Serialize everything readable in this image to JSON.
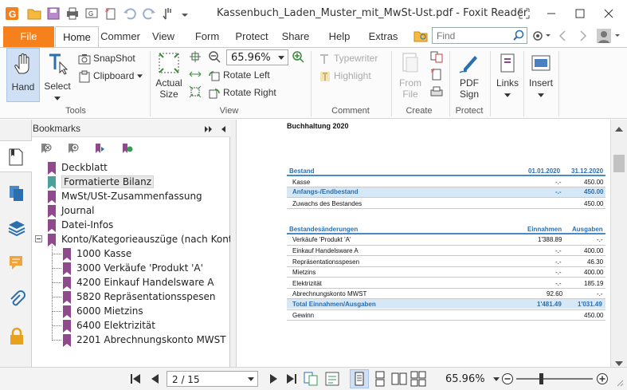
{
  "window": {
    "title": "Kassenbuch_Laden_Muster_mit_MwSt-Ust.pdf - Foxit Reader"
  },
  "menu": {
    "file": "File",
    "tabs": [
      "Home",
      "Commer",
      "View",
      "Form",
      "Protect",
      "Share",
      "Help",
      "Extras"
    ],
    "find_placeholder": "Find"
  },
  "ribbon": {
    "tools": {
      "hand": "Hand",
      "select": "Select",
      "snapshot": "SnapShot",
      "clipboard": "Clipboard",
      "label": "Tools"
    },
    "view": {
      "actual_size_1": "Actual",
      "actual_size_2": "Size",
      "zoom_value": "65.96%",
      "rotate_left": "Rotate Left",
      "rotate_right": "Rotate Right",
      "label": "View"
    },
    "comment": {
      "typewriter": "Typewriter",
      "highlight": "Highlight",
      "label": "Comment"
    },
    "create": {
      "from_file_1": "From",
      "from_file_2": "File",
      "label": "Create"
    },
    "protect": {
      "pdf_sign_1": "PDF",
      "pdf_sign_2": "Sign",
      "label": "Protect"
    },
    "links": {
      "links": "Links"
    },
    "insert": {
      "insert": "Insert"
    }
  },
  "bookmarks": {
    "title": "Bookmarks",
    "items": [
      "Deckblatt",
      "Formatierte Bilanz",
      "MwSt/USt-Zusammenfassung",
      "Journal",
      "Datei-Infos",
      "Konto/Kategorieauszüge (nach Konto"
    ],
    "children": [
      "1000 Kasse",
      "3000 Verkäufe 'Produkt 'A'",
      "4200 Einkauf Handelsware A",
      "5820 Repräsentationsspesen",
      "6000 Mietzins",
      "6400 Elektrizität",
      "2201 Abrechnungskonto MWST"
    ]
  },
  "document": {
    "heading": "Buchhaltung 2020",
    "table1": {
      "headers": [
        "Bestand",
        "01.01.2020",
        "31.12.2020"
      ],
      "rows": [
        [
          "Kasse",
          "-.-",
          "450.00"
        ],
        [
          "Anfangs-/Endbestand",
          "-.-",
          "450.00"
        ],
        [
          "Zuwachs des Bestandes",
          "",
          "450.00"
        ]
      ]
    },
    "table2": {
      "headers": [
        "Bestandesänderungen",
        "Einnahmen",
        "Ausgaben"
      ],
      "rows": [
        [
          "Verkäufe 'Produkt 'A'",
          "1'388.89",
          "-.-"
        ],
        [
          "Einkauf Handelsware A",
          "-.-",
          "400.00"
        ],
        [
          "Repräsentationsspesen",
          "-.-",
          "46.30"
        ],
        [
          "Mietzins",
          "-.-",
          "400.00"
        ],
        [
          "Elektrizität",
          "-.-",
          "185.19"
        ],
        [
          "Abrechnungskonto MWST",
          "92.60",
          "-.-"
        ],
        [
          "Total Einnahmen/Ausgaben",
          "1'481.49",
          "1'031.49"
        ],
        [
          "Gewinn",
          "",
          "450.00"
        ]
      ]
    }
  },
  "status": {
    "page": "2 / 15",
    "zoom": "65.96%"
  },
  "colors": {
    "file_tab": "#f6811c",
    "accent_blue": "#2a6fb0",
    "bookmark_purple": "#8e4a8c",
    "bookmark_teal": "#4aa29a"
  }
}
